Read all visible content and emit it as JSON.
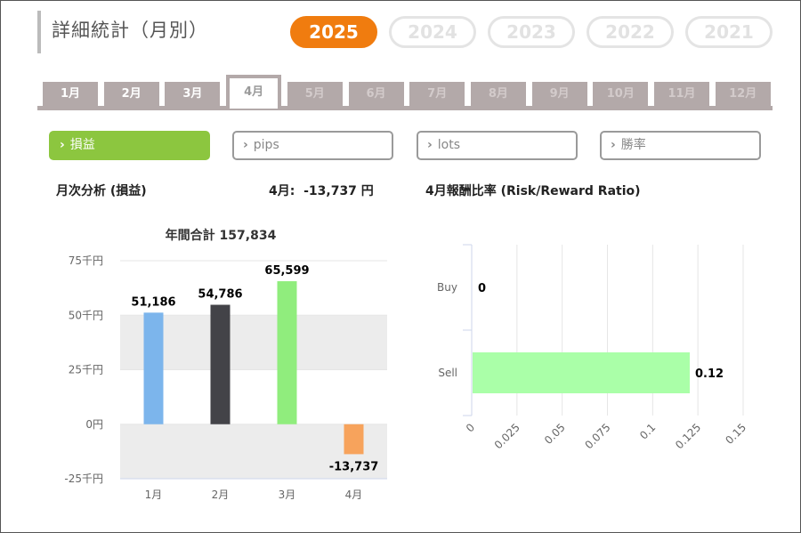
{
  "page_title": "詳細統計（月別）",
  "years": [
    {
      "label": "2025",
      "active": true
    },
    {
      "label": "2024",
      "active": false
    },
    {
      "label": "2023",
      "active": false
    },
    {
      "label": "2022",
      "active": false
    },
    {
      "label": "2021",
      "active": false
    }
  ],
  "months": [
    {
      "label": "1月",
      "state": "enabled"
    },
    {
      "label": "2月",
      "state": "enabled"
    },
    {
      "label": "3月",
      "state": "enabled"
    },
    {
      "label": "4月",
      "state": "active"
    },
    {
      "label": "5月",
      "state": "disabled"
    },
    {
      "label": "6月",
      "state": "disabled"
    },
    {
      "label": "7月",
      "state": "disabled"
    },
    {
      "label": "8月",
      "state": "disabled"
    },
    {
      "label": "9月",
      "state": "disabled"
    },
    {
      "label": "10月",
      "state": "disabled"
    },
    {
      "label": "11月",
      "state": "disabled"
    },
    {
      "label": "12月",
      "state": "disabled"
    }
  ],
  "metrics": [
    {
      "label": "損益",
      "active": true
    },
    {
      "label": "pips",
      "active": false
    },
    {
      "label": "lots",
      "active": false
    },
    {
      "label": "勝率",
      "active": false
    }
  ],
  "monthly_header": "月次分析 (損益)",
  "current_month_value": "4月:  -13,737 円",
  "ratio_header": "4月報酬比率 (Risk/Reward Ratio)",
  "chart_data": [
    {
      "type": "bar",
      "title": "年間合計 157,834",
      "categories": [
        "1月",
        "2月",
        "3月",
        "4月"
      ],
      "values": [
        51186,
        54786,
        65599,
        -13737
      ],
      "data_labels": [
        "51,186",
        "54,786",
        "65,599",
        "-13,737"
      ],
      "colors": [
        "#7cb5ec",
        "#434348",
        "#90ed7d",
        "#f7a35c"
      ],
      "ylim": [
        -25000,
        75000
      ],
      "y_ticks": [
        75000,
        50000,
        25000,
        0,
        -25000
      ],
      "y_tick_labels": [
        "75千円",
        "50千円",
        "25千円",
        "0円",
        "-25千円"
      ],
      "bands": [
        [
          25000,
          50000
        ],
        [
          -25000,
          0
        ]
      ],
      "band_color": "#ececec"
    },
    {
      "type": "bar",
      "orientation": "horizontal",
      "categories": [
        "Buy",
        "Sell"
      ],
      "values": [
        0,
        0.12
      ],
      "data_labels": [
        "0",
        "0.12"
      ],
      "color": "#aaffa8",
      "xlim": [
        0,
        0.15
      ],
      "x_ticks": [
        0,
        0.025,
        0.05,
        0.075,
        0.1,
        0.125,
        0.15
      ],
      "x_tick_labels": [
        "0",
        "0.025",
        "0.05",
        "0.075",
        "0.1",
        "0.125",
        "0.15"
      ],
      "grid": true
    }
  ]
}
